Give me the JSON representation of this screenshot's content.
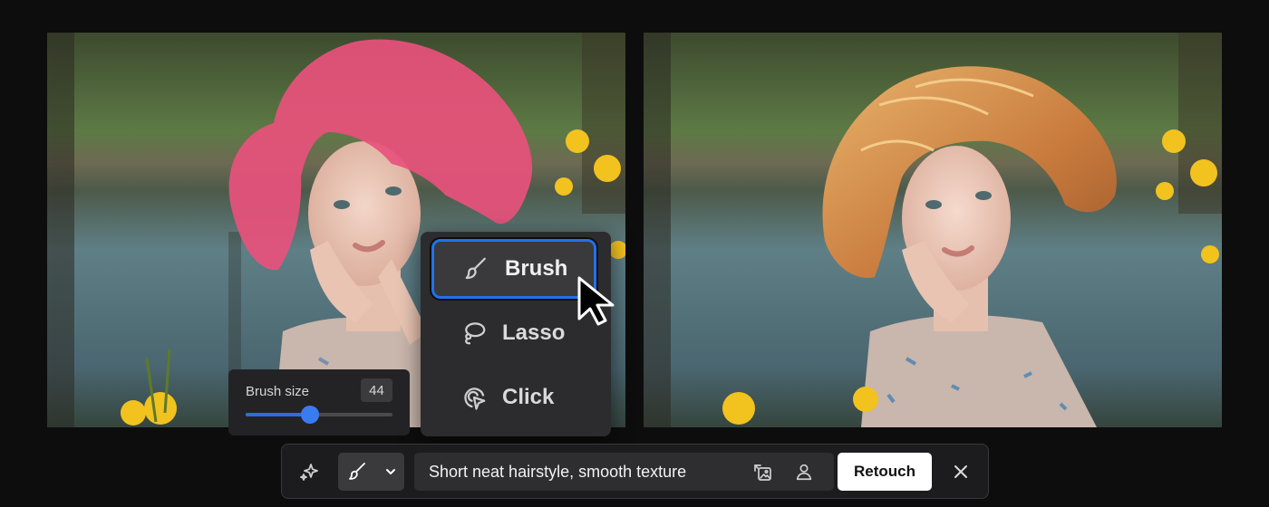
{
  "images": {
    "left": {
      "icon": "photo-with-hair-mask"
    },
    "right": {
      "icon": "photo-retouched-result"
    }
  },
  "selection_menu": {
    "items": [
      {
        "label": "Brush",
        "icon": "brush-icon",
        "selected": true
      },
      {
        "label": "Lasso",
        "icon": "lasso-icon",
        "selected": false
      },
      {
        "label": "Click",
        "icon": "click-select-icon",
        "selected": false
      }
    ]
  },
  "brush_size": {
    "label": "Brush size",
    "value": "44",
    "level": 0.44
  },
  "toolbar": {
    "prompt_value": "Short neat hairstyle, smooth texture",
    "retouch_label": "Retouch",
    "icons": [
      "sparkle-icon",
      "brush-icon",
      "chevron-down-icon",
      "image-reference-icon",
      "person-icon",
      "close-icon"
    ]
  },
  "colors": {
    "accent": "#1f73ea",
    "mask": "#e8517c",
    "toolbar_bg": "#1c1c1e",
    "retouch_bg": "#ffffff"
  }
}
